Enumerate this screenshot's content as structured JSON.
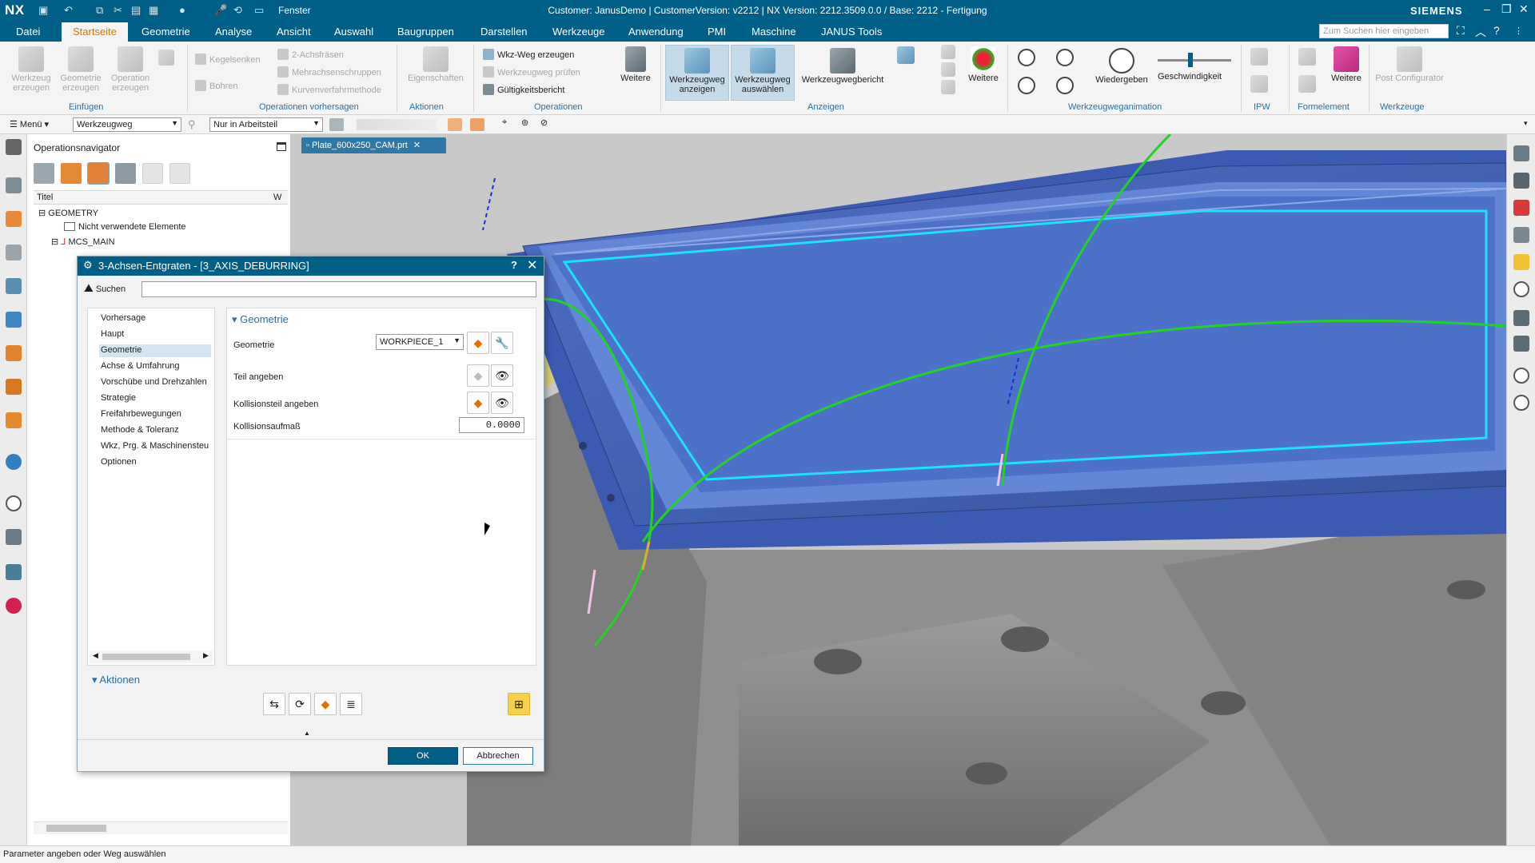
{
  "app": {
    "logo": "NX",
    "title": "Customer: JanusDemo | CustomerVersion: v2212 | NX Version: 2212.3509.0.0 / Base: 2212 - Fertigung",
    "window_menu": "Fenster",
    "brand": "SIEMENS"
  },
  "menu": {
    "tabs": [
      "Datei",
      "Startseite",
      "Geometrie",
      "Analyse",
      "Ansicht",
      "Auswahl",
      "Baugruppen",
      "Darstellen",
      "Werkzeuge",
      "Anwendung",
      "PMI",
      "Maschine",
      "JANUS Tools"
    ],
    "search_placeholder": "Zum Suchen hier eingeben"
  },
  "ribbon": {
    "insert": {
      "b1": "Werkzeug erzeugen",
      "b2": "Geometrie erzeugen",
      "b3": "Operation erzeugen",
      "group": "Einfügen"
    },
    "prefab": {
      "s1": "Kegelsenken",
      "s2": "Bohren",
      "s3": "2-Achsfräsen",
      "s4": "Mehrachsenschruppen",
      "s5": "Kurvenverfahrmethode",
      "group": "Operationen vorhersagen"
    },
    "actions": {
      "b1": "Eigenschaften",
      "group": "Aktionen"
    },
    "ops": {
      "s1": "Wkz-Weg erzeugen",
      "s2": "Werkzeugweg prüfen",
      "s3": "Gültigkeitsbericht",
      "b1": "Weitere",
      "group": "Operationen"
    },
    "display": {
      "b1": "Werkzeugweg anzeigen",
      "b2": "Werkzeugweg auswählen",
      "b3": "Werkzeugwegbericht",
      "b4": "Weitere",
      "group": "Anzeigen"
    },
    "anim": {
      "b1": "Wiedergeben",
      "speed": "Geschwindigkeit",
      "group": "Werkzeugweganimation"
    },
    "ipw": {
      "group": "IPW"
    },
    "formula": {
      "b1": "Weitere",
      "group": "Formelement"
    },
    "tools": {
      "b1": "Post Configurator",
      "group": "Werkzeuge"
    }
  },
  "toolbar2": {
    "menu": "Menü",
    "filter1": "Werkzeugweg",
    "filter2": "Nur in Arbeitsteil"
  },
  "navigator": {
    "title": "Operationsnavigator",
    "col_title": "Titel",
    "col_w": "W",
    "items": [
      "GEOMETRY",
      "Nicht verwendete Elemente",
      "MCS_MAIN"
    ]
  },
  "viewport": {
    "tab": "Plate_600x250_CAM.prt"
  },
  "dialog": {
    "title": "3-Achsen-Entgraten - [3_AXIS_DEBURRING]",
    "help": "?",
    "search_label": "Suchen",
    "list": [
      "Vorhersage",
      "Haupt",
      "Geometrie",
      "Achse & Umfahrung",
      "Vorschübe und Drehzahlen",
      "Strategie",
      "Freifahrbewegungen",
      "Methode & Toleranz",
      "Wkz, Prg. & Maschinensteu",
      "Optionen"
    ],
    "section": "Geometrie",
    "geometry_label": "Geometrie",
    "geometry_value": "WORKPIECE_1",
    "part_label": "Teil angeben",
    "collision_label": "Kollisionsteil angeben",
    "allowance_label": "Kollisionsaufmaß",
    "allowance_value": "0.0000",
    "actions_label": "Aktionen",
    "ok": "OK",
    "cancel": "Abbrechen"
  },
  "status": "Parameter angeben oder Weg auswählen",
  "colors": {
    "accent": "#005f87",
    "active_tab": "#e07000",
    "toolpath_green": "#22d322",
    "contour_cyan": "#1ee0ff",
    "plate_blue": "#3f5fb0"
  }
}
